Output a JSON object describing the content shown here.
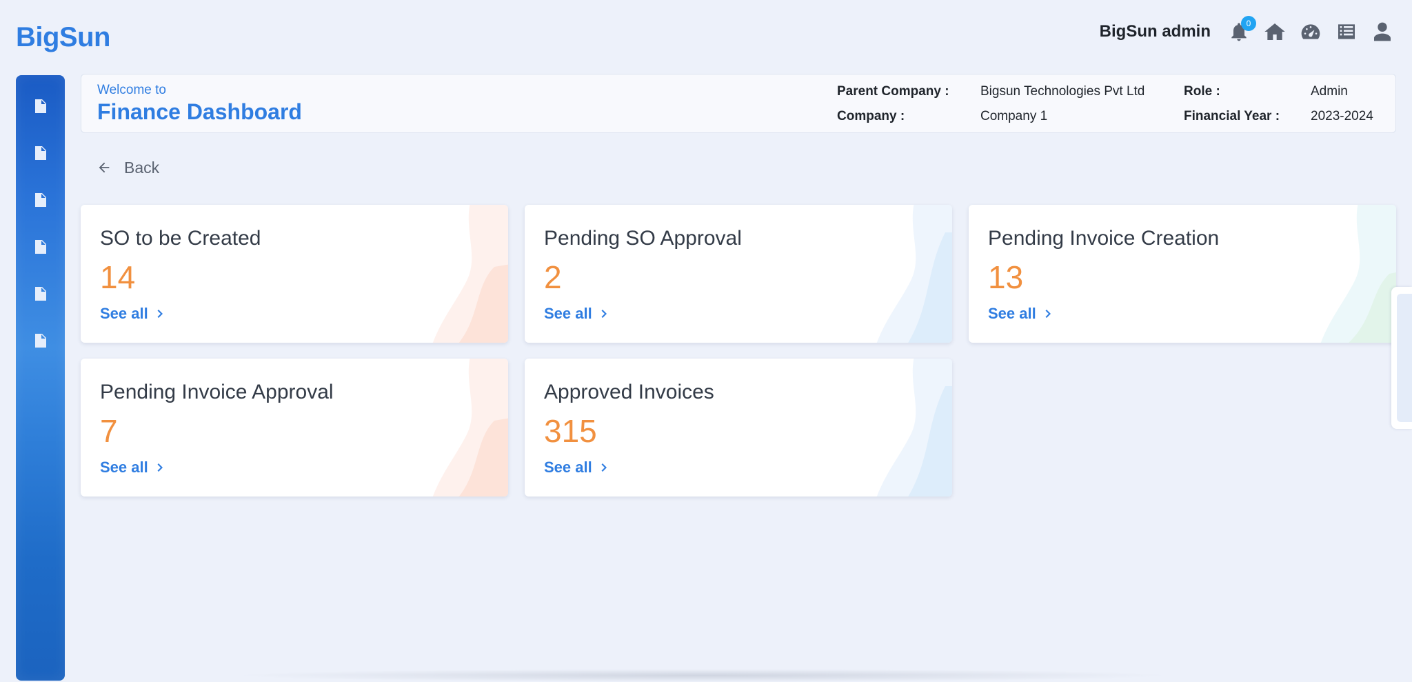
{
  "header": {
    "logo": "BigSun",
    "user_name": "BigSun admin",
    "notification_count": "0",
    "icons": [
      "bell-icon",
      "home-icon",
      "dashboard-gauge-icon",
      "list-icon",
      "user-icon"
    ]
  },
  "sidebar": {
    "items": [
      {
        "icon": "document-icon"
      },
      {
        "icon": "document-icon"
      },
      {
        "icon": "document-icon"
      },
      {
        "icon": "document-icon"
      },
      {
        "icon": "document-icon"
      },
      {
        "icon": "document-icon"
      }
    ]
  },
  "infobar": {
    "welcome": "Welcome to",
    "title": "Finance Dashboard",
    "parent_company_label": "Parent Company :",
    "parent_company_value": "Bigsun Technologies Pvt Ltd",
    "company_label": "Company :",
    "company_value": "Company 1",
    "role_label": "Role :",
    "role_value": "Admin",
    "fy_label": "Financial Year :",
    "fy_value": "2023-2024"
  },
  "back": {
    "label": "Back"
  },
  "cards": [
    {
      "title": "SO to be Created",
      "count": "14",
      "link": "See all",
      "accent": "#f8a88a"
    },
    {
      "title": "Pending SO Approval",
      "count": "2",
      "link": "See all",
      "accent": "#8cc8f0"
    },
    {
      "title": "Pending Invoice Creation",
      "count": "13",
      "link": "See all",
      "accent": "#9fe0d0"
    },
    {
      "title": "Pending Invoice Approval",
      "count": "7",
      "link": "See all",
      "accent": "#f8a88a"
    },
    {
      "title": "Approved Invoices",
      "count": "315",
      "link": "See all",
      "accent": "#8cc8f0"
    }
  ],
  "colors": {
    "brand": "#2f7de1",
    "count": "#f1903f",
    "badge": "#21a4f2"
  }
}
